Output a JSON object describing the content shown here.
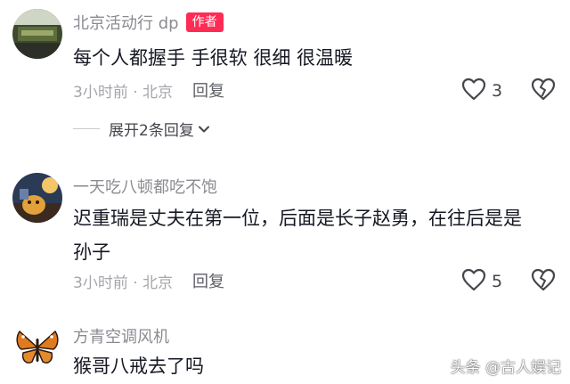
{
  "comments": [
    {
      "username": "北京活动行 dp",
      "badge": "作者",
      "text": "每个人都握手 手很软 很细 很温暖",
      "time_location": "3小时前 · 北京",
      "reply_label": "回复",
      "likes": "3",
      "expand_label": "展开2条回复"
    },
    {
      "username": "一天吃八顿都吃不饱",
      "text": "迟重瑞是丈夫在第一位，后面是长子赵勇，在往后是是\n孙子",
      "time_location": "3小时前 · 北京",
      "reply_label": "回复",
      "likes": "5"
    },
    {
      "username": "方青空调风机",
      "text": "猴哥八戒去了吗"
    }
  ],
  "watermark": "头条 @古人娱记",
  "icons": {
    "like": "heart-outline-icon",
    "dislike": "broken-heart-icon",
    "expand": "chevron-down-icon"
  },
  "colors": {
    "author_badge": "#fe2c55",
    "username": "#8a8b91",
    "meta": "#a5a6ab"
  }
}
